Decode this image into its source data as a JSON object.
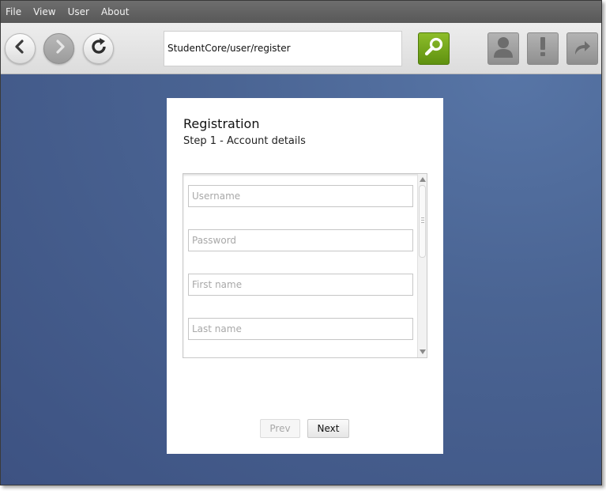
{
  "menu": {
    "items": [
      "File",
      "View",
      "User",
      "About"
    ]
  },
  "toolbar": {
    "address_value": "StudentCore/user/register",
    "back_icon": "back-arrow-icon",
    "forward_icon": "forward-arrow-icon",
    "refresh_icon": "refresh-icon",
    "search_icon": "magnifier-icon",
    "user_icon": "user-icon",
    "alert_icon": "exclamation-icon",
    "share_icon": "share-arrow-icon"
  },
  "form": {
    "title": "Registration",
    "step": "Step 1 - Account details",
    "fields": {
      "username_placeholder": "Username",
      "password_placeholder": "Password",
      "firstname_placeholder": "First name",
      "lastname_placeholder": "Last name"
    },
    "prev_label": "Prev",
    "next_label": "Next"
  },
  "colors": {
    "accent_go": "#6fa21a",
    "background": "#4a6493",
    "menubar": "#5f5f5f"
  }
}
